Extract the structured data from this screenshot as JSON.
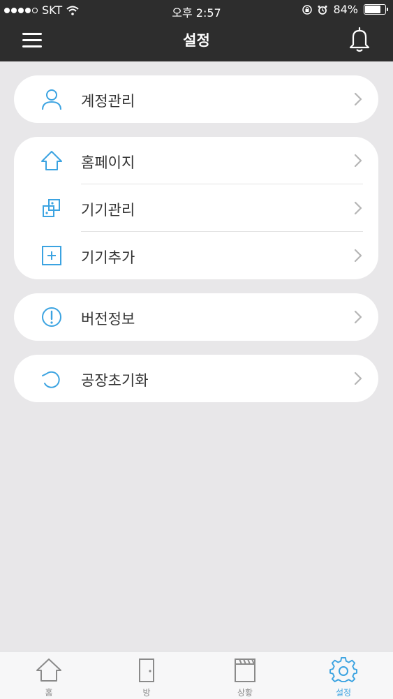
{
  "status_bar": {
    "carrier": "SKT",
    "time": "오후 2:57",
    "battery_percent": "84%",
    "battery_level": 0.84
  },
  "nav": {
    "title": "설정",
    "menu_icon": "hamburger-menu-icon",
    "bell_icon": "bell-icon"
  },
  "colors": {
    "accent": "#3ba3e1",
    "header_bg": "#2d2d2d",
    "page_bg": "#e8e7e9"
  },
  "settings": {
    "account": {
      "label": "계정관리",
      "icon": "user-icon"
    },
    "homepage": {
      "label": "홈페이지",
      "icon": "home-icon"
    },
    "device_manage": {
      "label": "기기관리",
      "icon": "device-icon"
    },
    "device_add": {
      "label": "기기추가",
      "icon": "plus-square-icon"
    },
    "version": {
      "label": "버전정보",
      "icon": "info-circle-icon"
    },
    "factory_reset": {
      "label": "공장초기화",
      "icon": "reset-icon"
    }
  },
  "tabs": [
    {
      "label": "홈",
      "icon": "home-icon"
    },
    {
      "label": "방",
      "icon": "door-icon"
    },
    {
      "label": "상황",
      "icon": "clapperboard-icon"
    },
    {
      "label": "설정",
      "icon": "gear-icon",
      "active": true
    }
  ]
}
